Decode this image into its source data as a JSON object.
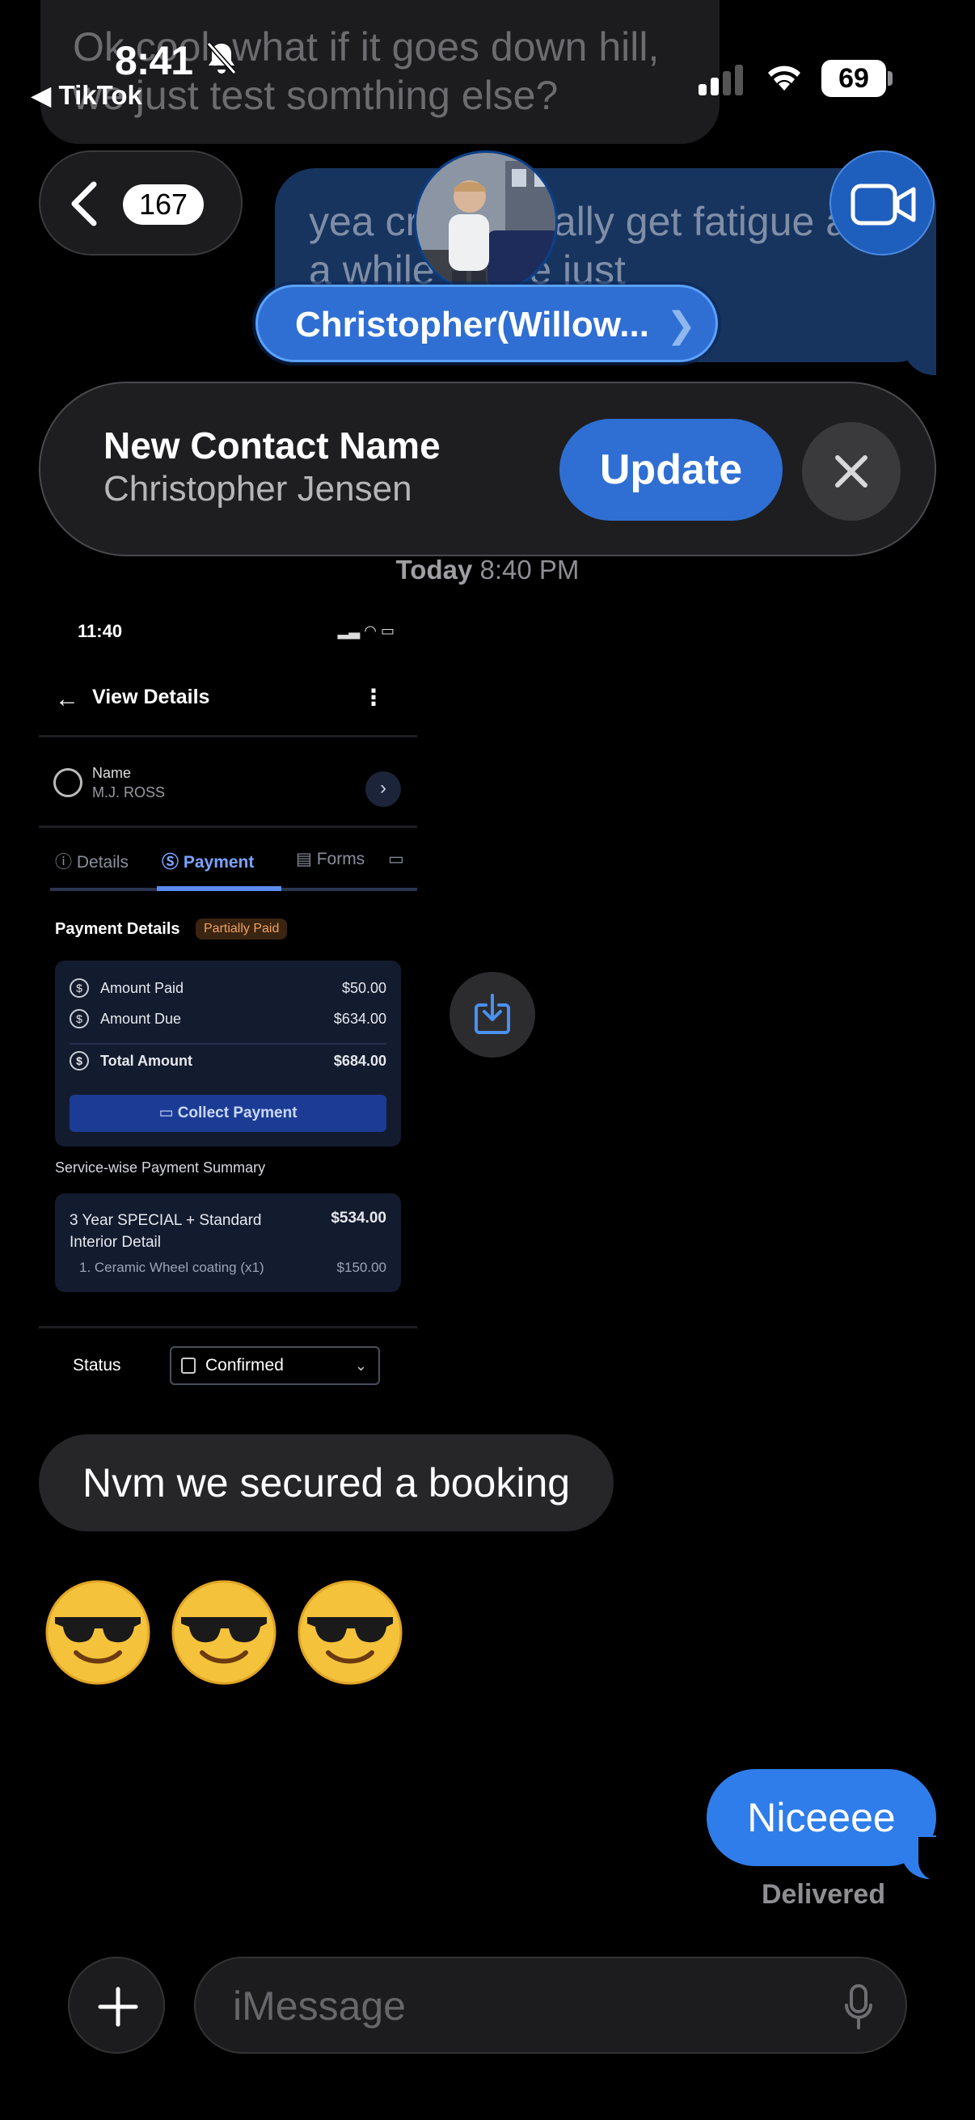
{
  "status_bar": {
    "time": "8:41",
    "back_app": "◀ TikTok",
    "battery": "69"
  },
  "background_messages": {
    "incoming": "Ok cool, what if it goes down hill, we just test somthing else?",
    "outgoing": "yea cr... normally get fatigue after a while so we just"
  },
  "header": {
    "unread_count": "167",
    "contact_name": "Christopher(Willow...",
    "contact_chevron": "❯"
  },
  "contact_update": {
    "heading": "New Contact Name",
    "name": "Christopher Jensen",
    "update_label": "Update"
  },
  "timestamp": {
    "day": "Today",
    "time": "8:40 PM"
  },
  "screenshot": {
    "time": "11:40",
    "title": "View Details",
    "name_label": "Name",
    "name_value": "M.J. ROSS",
    "tabs": [
      "Details",
      "Payment",
      "Forms"
    ],
    "payment_details_label": "Payment Details",
    "payment_status": "Partially Paid",
    "rows": [
      {
        "label": "Amount Paid",
        "value": "$50.00"
      },
      {
        "label": "Amount Due",
        "value": "$634.00"
      },
      {
        "label": "Total Amount",
        "value": "$684.00"
      }
    ],
    "collect_label": "Collect Payment",
    "summary_label": "Service-wise Payment Summary",
    "service_name": "3 Year SPECIAL + Standard Interior Detail",
    "service_price": "$534.00",
    "addon_name": "1. Ceramic Wheel coating (x1)",
    "addon_price": "$150.00",
    "status_label": "Status",
    "status_value": "Confirmed"
  },
  "messages": {
    "incoming_text": "Nvm we secured a booking",
    "emoji": [
      "😎",
      "😎",
      "😎"
    ],
    "outgoing_text": "Niceeee",
    "delivered": "Delivered"
  },
  "composer": {
    "placeholder": "iMessage"
  },
  "colors": {
    "blue_bubble": "#2f7dea",
    "incoming_bubble": "#262628",
    "accent_pill": "#2f6fd3"
  },
  "icons": [
    "bell-slash-icon",
    "signal-icon",
    "wifi-icon",
    "battery-icon",
    "back-chevron-icon",
    "video-camera-icon",
    "close-icon",
    "download-icon",
    "plus-icon",
    "microphone-icon"
  ]
}
